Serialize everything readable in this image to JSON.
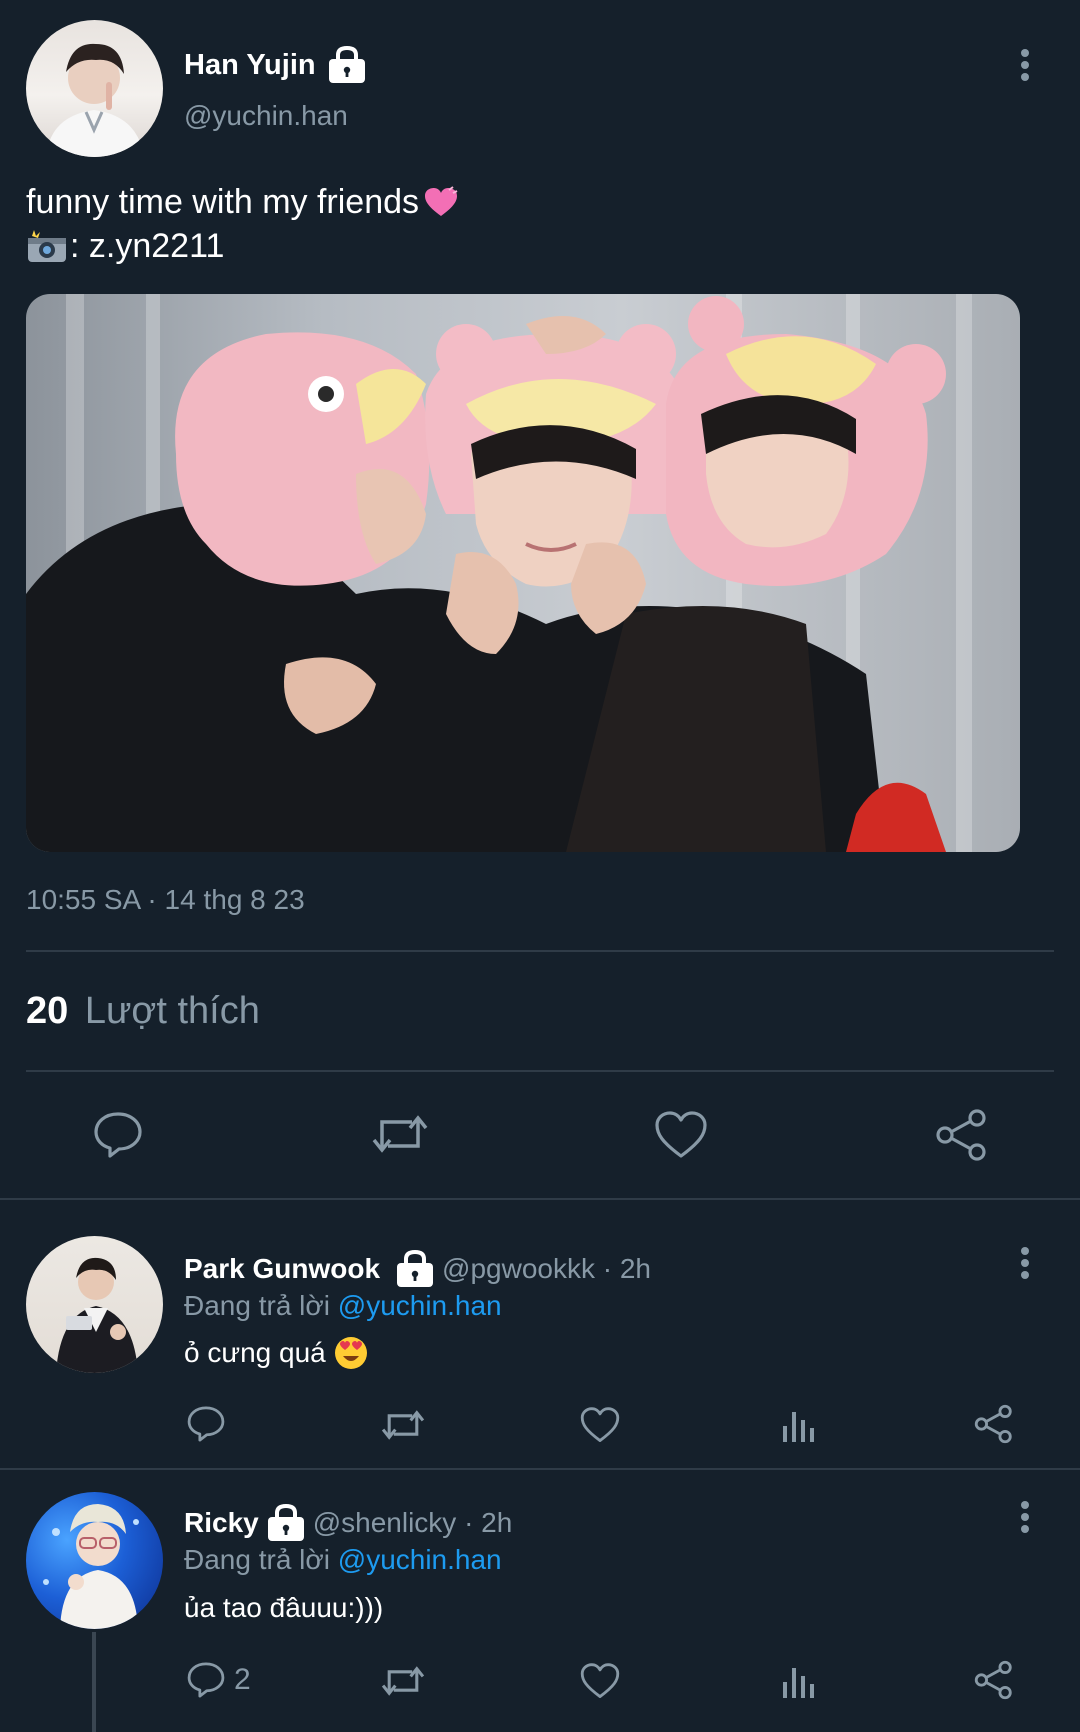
{
  "tweet": {
    "author_name": "Han Yujin",
    "author_handle": "@yuchin.han",
    "text_line1": "funny time with my friends",
    "text_line2": ": z.yn2211",
    "timestamp": "10:55 SA · 14 thg 8 23",
    "likes_count": "20",
    "likes_label": "Lượt thích"
  },
  "replies": [
    {
      "author_name": "Park Gunwook",
      "handle_time": "@pgwookkk · 2h",
      "replying_prefix": "Đang trả lời",
      "replying_to": "@yuchin.han",
      "text": "ỏ cưng quá",
      "reply_count": ""
    },
    {
      "author_name": "Ricky",
      "handle_time": "@shenlicky · 2h",
      "replying_prefix": "Đang trả lời",
      "replying_to": "@yuchin.han",
      "text": "ủa tao đâuuu:)))",
      "reply_count": "2"
    }
  ],
  "icons": {
    "reply": "speech-bubble-icon",
    "retweet": "retweet-icon",
    "like": "heart-icon",
    "share": "share-icon",
    "views": "bar-chart-icon",
    "more": "more-vertical-icon",
    "lock": "lock-icon",
    "camera": "camera-flash-icon",
    "heart_emoji": "heart-emoji-icon",
    "smile_emoji": "heart-eyes-emoji-icon"
  },
  "colors": {
    "background": "#15202b",
    "muted": "#8899a6",
    "link": "#1d9bf0",
    "divider": "#2f3b47"
  }
}
